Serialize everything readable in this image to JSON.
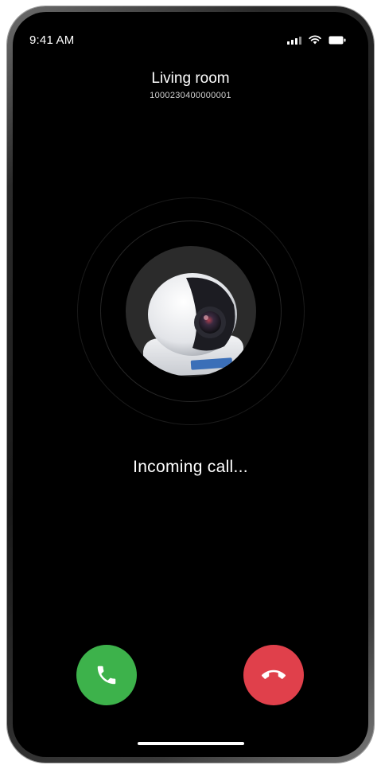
{
  "status_bar": {
    "time": "9:41 AM"
  },
  "caller": {
    "name": "Living room",
    "id": "1000230400000001"
  },
  "call": {
    "status": "Incoming call..."
  },
  "actions": {
    "answer_icon": "phone-icon",
    "decline_icon": "hang-up-icon"
  },
  "colors": {
    "answer": "#3db24b",
    "decline": "#e0404b",
    "background": "#000000"
  }
}
